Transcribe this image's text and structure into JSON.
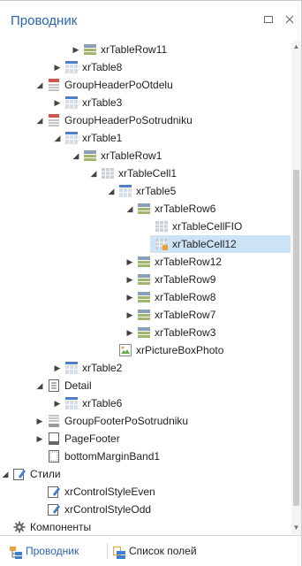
{
  "panel": {
    "title": "Проводник"
  },
  "tree": {
    "items": [
      {
        "label": "xrTableRow11",
        "expander": "right",
        "icon": "table-row-icon"
      },
      {
        "label": "xrTable8",
        "expander": "right",
        "icon": "table-icon"
      },
      {
        "label": "GroupHeaderPoOtdelu",
        "expander": "down",
        "icon": "group-header-icon"
      },
      {
        "label": "xrTable3",
        "expander": "right",
        "icon": "table-icon"
      },
      {
        "label": "GroupHeaderPoSotrudniku",
        "expander": "down",
        "icon": "group-header-icon"
      },
      {
        "label": "xrTable1",
        "expander": "down",
        "icon": "table-icon"
      },
      {
        "label": "xrTableRow1",
        "expander": "down",
        "icon": "table-row-icon"
      },
      {
        "label": "xrTableCell1",
        "expander": "down",
        "icon": "table-cell-icon"
      },
      {
        "label": "xrTable5",
        "expander": "down",
        "icon": "table-icon"
      },
      {
        "label": "xrTableRow6",
        "expander": "down",
        "icon": "table-row-icon"
      },
      {
        "label": "xrTableCellFIO",
        "expander": "",
        "icon": "table-cell-icon"
      },
      {
        "label": "xrTableCell12",
        "expander": "",
        "icon": "table-cell-selected-icon"
      },
      {
        "label": "xrTableRow12",
        "expander": "right",
        "icon": "table-row-icon"
      },
      {
        "label": "xrTableRow9",
        "expander": "right",
        "icon": "table-row-icon"
      },
      {
        "label": "xrTableRow8",
        "expander": "right",
        "icon": "table-row-icon"
      },
      {
        "label": "xrTableRow7",
        "expander": "right",
        "icon": "table-row-icon"
      },
      {
        "label": "xrTableRow3",
        "expander": "right",
        "icon": "table-row-icon"
      },
      {
        "label": "xrPictureBoxPhoto",
        "expander": "",
        "icon": "picture-box-icon"
      },
      {
        "label": "xrTable2",
        "expander": "right",
        "icon": "table-icon"
      },
      {
        "label": "Detail",
        "expander": "down",
        "icon": "detail-band-icon"
      },
      {
        "label": "xrTable6",
        "expander": "right",
        "icon": "table-icon"
      },
      {
        "label": "GroupFooterPoSotrudniku",
        "expander": "right",
        "icon": "group-footer-icon"
      },
      {
        "label": "PageFooter",
        "expander": "right",
        "icon": "page-footer-icon"
      },
      {
        "label": "bottomMarginBand1",
        "expander": "",
        "icon": "margin-band-icon"
      },
      {
        "label": "Стили",
        "expander": "down",
        "icon": "styles-icon"
      },
      {
        "label": "xrControlStyleEven",
        "expander": "",
        "icon": "control-style-icon"
      },
      {
        "label": "xrControlStyleOdd",
        "expander": "",
        "icon": "control-style-icon"
      },
      {
        "label": "Компоненты",
        "expander": "",
        "icon": "components-gear-icon"
      }
    ]
  },
  "tabs": {
    "explorer_label": "Проводник",
    "fields_label": "Список полей"
  },
  "colors": {
    "accent": "#2a64b3",
    "selected_bg": "#cde4f7"
  }
}
